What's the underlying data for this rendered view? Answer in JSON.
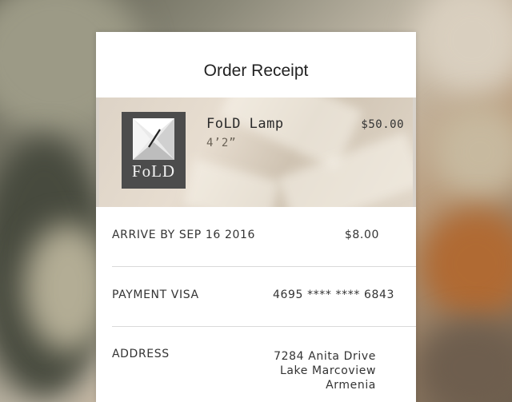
{
  "title": "Order Receipt",
  "product": {
    "brand": "FoLD",
    "name": "FoLD Lamp",
    "size": "4’2”",
    "price": "$50.00"
  },
  "arrival": {
    "label": "ARRIVE BY SEP 16 2016",
    "value": "$8.00"
  },
  "payment": {
    "label": "PAYMENT VISA",
    "value": "4695 **** **** 6843"
  },
  "address": {
    "label": "ADDRESS",
    "line1": "7284 Anita Drive",
    "line2": "Lake Marcoview",
    "line3": "Armenia"
  },
  "colors": {
    "card": "#ffffff",
    "text": "#333333",
    "thumb": "#4c4c4c"
  }
}
